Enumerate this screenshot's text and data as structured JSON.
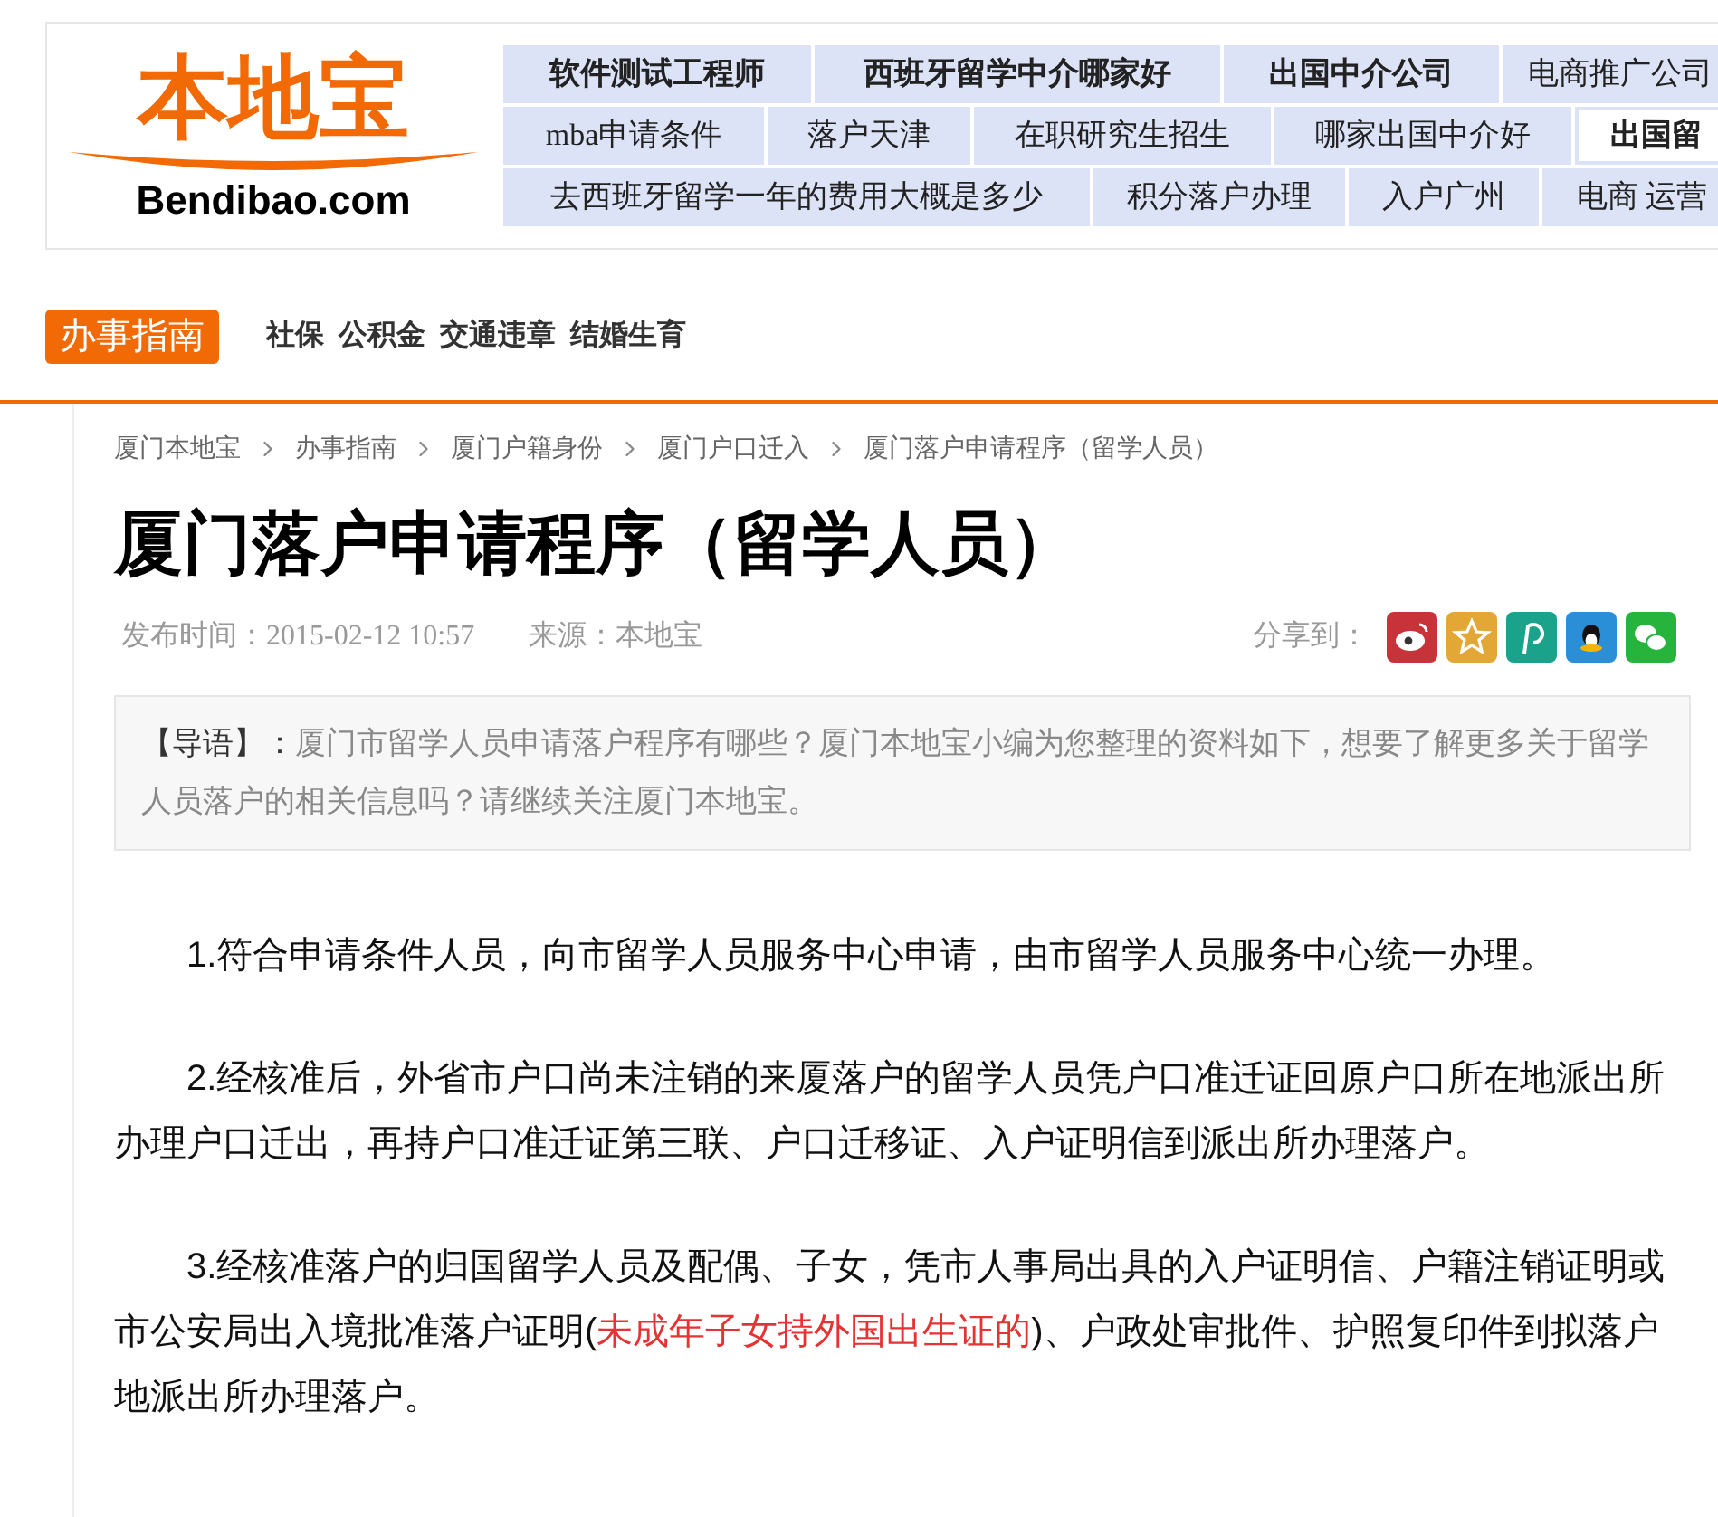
{
  "logo": {
    "title": "本地宝",
    "domain": "Bendibao.com"
  },
  "tag_rows": [
    [
      {
        "label": "软件测试工程师",
        "bold": true,
        "highlighted": false
      },
      {
        "label": "西班牙留学中介哪家好",
        "bold": true,
        "highlighted": false
      },
      {
        "label": "出国中介公司",
        "bold": true,
        "highlighted": false
      },
      {
        "label": "电商推广公司",
        "bold": false,
        "highlighted": false
      }
    ],
    [
      {
        "label": "mba申请条件",
        "bold": false,
        "highlighted": false
      },
      {
        "label": "落户天津",
        "bold": false,
        "highlighted": false
      },
      {
        "label": "在职研究生招生",
        "bold": false,
        "highlighted": false
      },
      {
        "label": "哪家出国中介好",
        "bold": false,
        "highlighted": false
      },
      {
        "label": "出国留",
        "bold": true,
        "highlighted": true
      }
    ],
    [
      {
        "label": "去西班牙留学一年的费用大概是多少",
        "bold": false,
        "highlighted": false
      },
      {
        "label": "积分落户办理",
        "bold": false,
        "highlighted": false
      },
      {
        "label": "入户广州",
        "bold": false,
        "highlighted": false
      },
      {
        "label": "电商 运营",
        "bold": false,
        "highlighted": false
      }
    ]
  ],
  "nav": {
    "section": "办事指南",
    "links": [
      "社保",
      "公积金",
      "交通违章",
      "结婚生育"
    ]
  },
  "breadcrumb": [
    "厦门本地宝",
    "办事指南",
    "厦门户籍身份",
    "厦门户口迁入",
    "厦门落户申请程序（留学人员）"
  ],
  "article": {
    "title": "厦门落户申请程序（留学人员）",
    "published": "发布时间：2015-02-12 10:57",
    "source": "来源：本地宝",
    "share_label": "分享到：",
    "share": [
      {
        "kind": "weibo",
        "color": "#c8333a"
      },
      {
        "kind": "star",
        "color": "#e2a735"
      },
      {
        "kind": "p",
        "color": "#1aa38a"
      },
      {
        "kind": "penguin",
        "color": "#2a8fd6"
      },
      {
        "kind": "chat",
        "color": "#27b43c"
      }
    ],
    "intro_label": "【导语】：",
    "intro": "厦门市留学人员申请落户程序有哪些？厦门本地宝小编为您整理的资料如下，想要了解更多关于留学人员落户的相关信息吗？请继续关注厦门本地宝。",
    "paragraphs": [
      [
        {
          "kind": "text",
          "text": "1.符合申请条件人员，向市留学人员服务中心申请，由市留学人员服务中心统一办理。"
        }
      ],
      [
        {
          "kind": "text",
          "text": "2.经核准后，外省市户口尚未注销的来厦落户的留学人员凭户口准迁证回原户口所在地派出所办理户口迁出，再持户口准迁证第三联、户口迁移证、入户证明信到派出所办理落户。"
        }
      ],
      [
        {
          "kind": "text",
          "text": "3.经核准落户的归国留学人员及配偶、子女，凭市人事局出具的入户证明信、户籍注销证明或市公安局出入境批准落户证明("
        },
        {
          "kind": "link",
          "text": "未成年子女持外国出生证的"
        },
        {
          "kind": "text",
          "text": ")、户政处审批件、护照复印件到拟落户地派出所办理落户。"
        }
      ]
    ]
  }
}
